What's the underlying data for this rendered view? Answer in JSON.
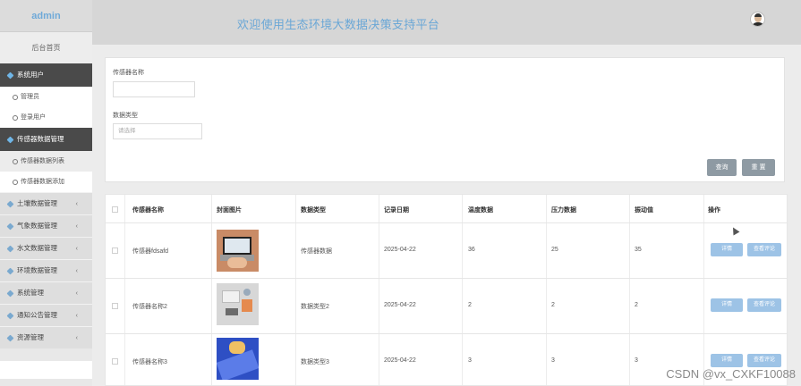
{
  "sidebar": {
    "brand": "admin",
    "home": "后台首页",
    "groups": [
      {
        "label": "系统用户",
        "items": [
          "管理员",
          "登录用户"
        ]
      },
      {
        "label": "传感器数据管理",
        "items": [
          "传感器数据列表",
          "传感器数据添加"
        ]
      }
    ],
    "closed_groups": [
      "土壤数据管理",
      "气象数据管理",
      "水文数据管理",
      "环境数据管理",
      "系统管理",
      "通知公告管理",
      "资源管理"
    ]
  },
  "header": {
    "title": "欢迎使用生态环境大数据决策支持平台"
  },
  "search": {
    "name_label": "传感器名称",
    "name_value": "",
    "type_label": "数据类型",
    "type_placeholder": "请选择",
    "query_button": "查询",
    "reset_button": "重 置"
  },
  "table": {
    "headers": [
      "传感器名称",
      "封面图片",
      "数据类型",
      "记录日期",
      "温度数据",
      "压力数据",
      "振动值",
      "操作"
    ],
    "rows": [
      {
        "name": "传感器fdsafd",
        "type": "传感器数据",
        "date": "2025-04-22",
        "temp": "36",
        "pressure": "25",
        "vibration": "35",
        "btn1": "详情",
        "btn2": "查看评论"
      },
      {
        "name": "传感器名称2",
        "type": "数据类型2",
        "date": "2025-04-22",
        "temp": "2",
        "pressure": "2",
        "vibration": "2",
        "btn1": "详情",
        "btn2": "查看评论"
      },
      {
        "name": "传感器名称3",
        "type": "数据类型3",
        "date": "2025-04-22",
        "temp": "3",
        "pressure": "3",
        "vibration": "3",
        "btn1": "详情",
        "btn2": "查看评论"
      }
    ]
  },
  "watermark": "CSDN @vx_CXKF10088",
  "colors": {
    "accent": "#6aa7d6",
    "sidebar_active": "#4a4a4a",
    "op_button": "#9dc3e6",
    "search_button": "#8e9aa3"
  }
}
